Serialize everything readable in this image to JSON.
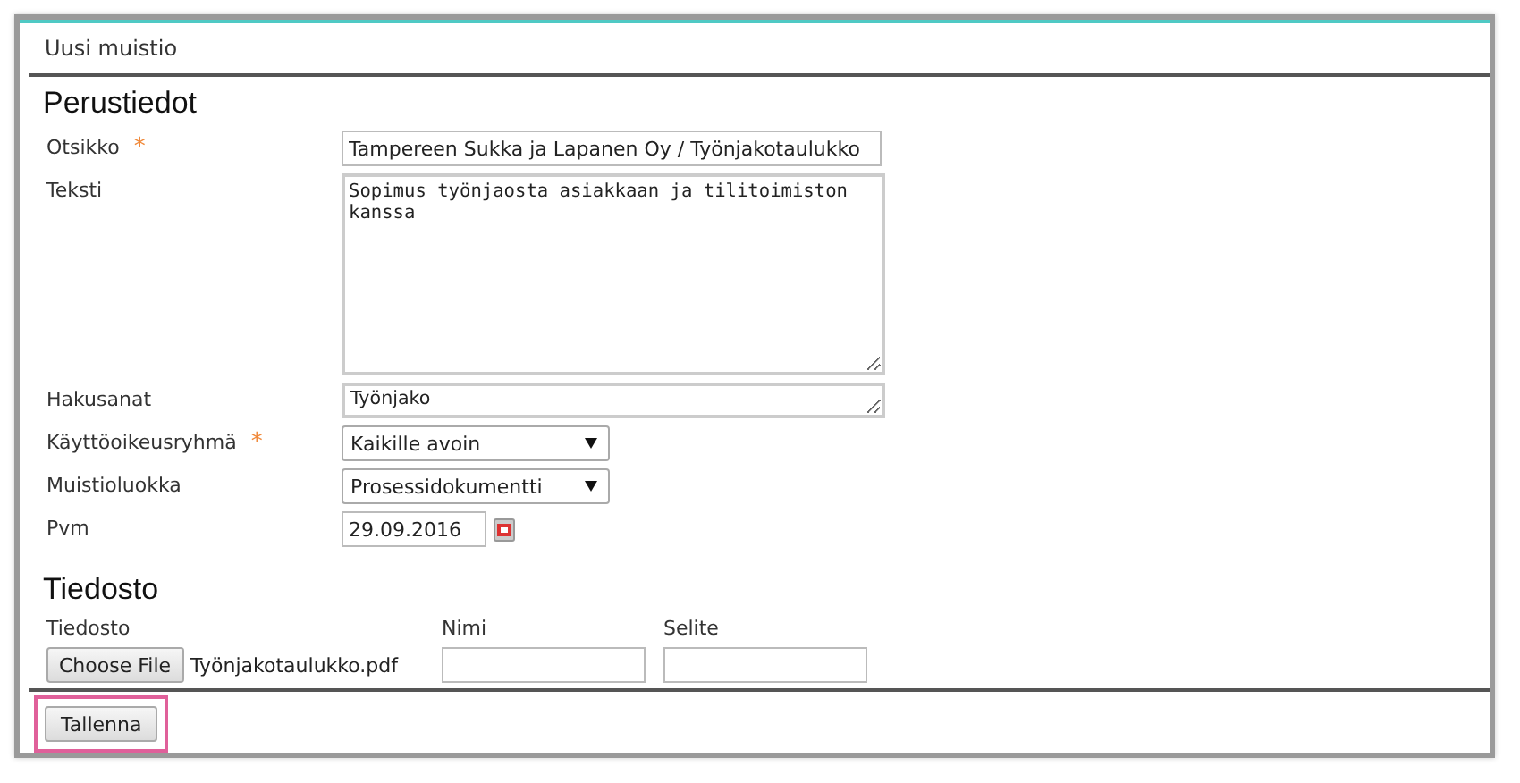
{
  "window": {
    "title": "Uusi muistio"
  },
  "basic_section": {
    "heading": "Perustiedot",
    "fields": [
      {
        "kind": "text",
        "label": "Otsikko",
        "required_mark": "*",
        "value": "Tampereen Sukka ja Lapanen Oy / Työnjakotaulukko"
      },
      {
        "kind": "textarea",
        "label": "Teksti",
        "value": "Sopimus työnjaosta asiakkaan ja tilitoimiston kanssa"
      },
      {
        "kind": "keywords",
        "label": "Hakusanat",
        "value": "Työnjako"
      },
      {
        "kind": "select",
        "label": "Käyttöoikeusryhmä",
        "required_mark": "*",
        "value": "Kaikille avoin"
      },
      {
        "kind": "select",
        "label": "Muistioluokka",
        "value": "Prosessidokumentti"
      },
      {
        "kind": "date",
        "label": "Pvm",
        "value": "29.09.2016"
      }
    ]
  },
  "file_section": {
    "heading": "Tiedosto",
    "file_label": "Tiedosto",
    "choose_button": "Choose File",
    "file_name": "Työnjakotaulukko.pdf",
    "name_label": "Nimi",
    "description_label": "Selite"
  },
  "save_button": {
    "label": "Tallenna",
    "highlighted": true
  }
}
